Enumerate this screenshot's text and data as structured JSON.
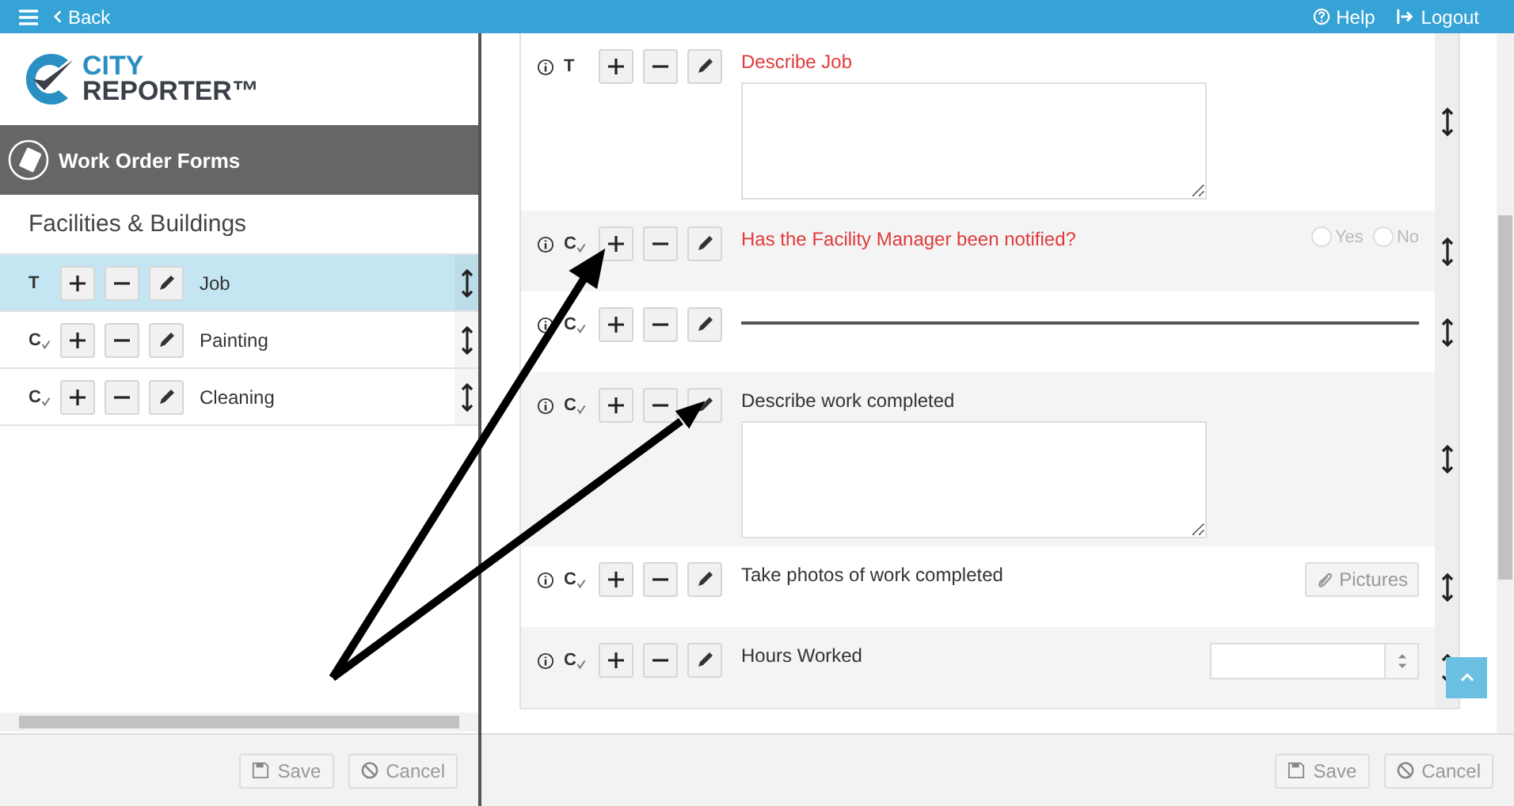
{
  "topbar": {
    "back": "Back",
    "help": "Help",
    "logout": "Logout"
  },
  "logo": {
    "line1": "CITY",
    "line2": "REPORTER™"
  },
  "section": {
    "title": "Work Order Forms"
  },
  "group_title": "Facilities & Buildings",
  "forms": [
    {
      "type_label": "T",
      "check_mark": false,
      "name": "Job",
      "selected": true
    },
    {
      "type_label": "C",
      "check_mark": true,
      "name": "Painting",
      "selected": false
    },
    {
      "type_label": "C",
      "check_mark": true,
      "name": "Cleaning",
      "selected": false
    }
  ],
  "fields": [
    {
      "kind": "textarea",
      "type_label": "T",
      "check_mark": false,
      "label": "Describe Job",
      "required": true
    },
    {
      "kind": "radio",
      "type_label": "C",
      "check_mark": true,
      "label": "Has the Facility Manager been notified?",
      "required": true,
      "options": [
        {
          "label": "Yes",
          "selected": false
        },
        {
          "label": "No",
          "selected": false
        }
      ]
    },
    {
      "kind": "divider",
      "type_label": "C",
      "check_mark": true
    },
    {
      "kind": "textarea",
      "type_label": "C",
      "check_mark": true,
      "label": "Describe work completed",
      "required": false
    },
    {
      "kind": "pictures",
      "type_label": "C",
      "check_mark": true,
      "label": "Take photos of work completed",
      "required": false,
      "button": "Pictures"
    },
    {
      "kind": "number",
      "type_label": "C",
      "check_mark": true,
      "label": "Hours Worked",
      "required": false
    }
  ],
  "left_footer": {
    "save": "Save",
    "cancel": "Cancel"
  },
  "right_footer": {
    "save": "Save",
    "cancel": "Cancel"
  }
}
